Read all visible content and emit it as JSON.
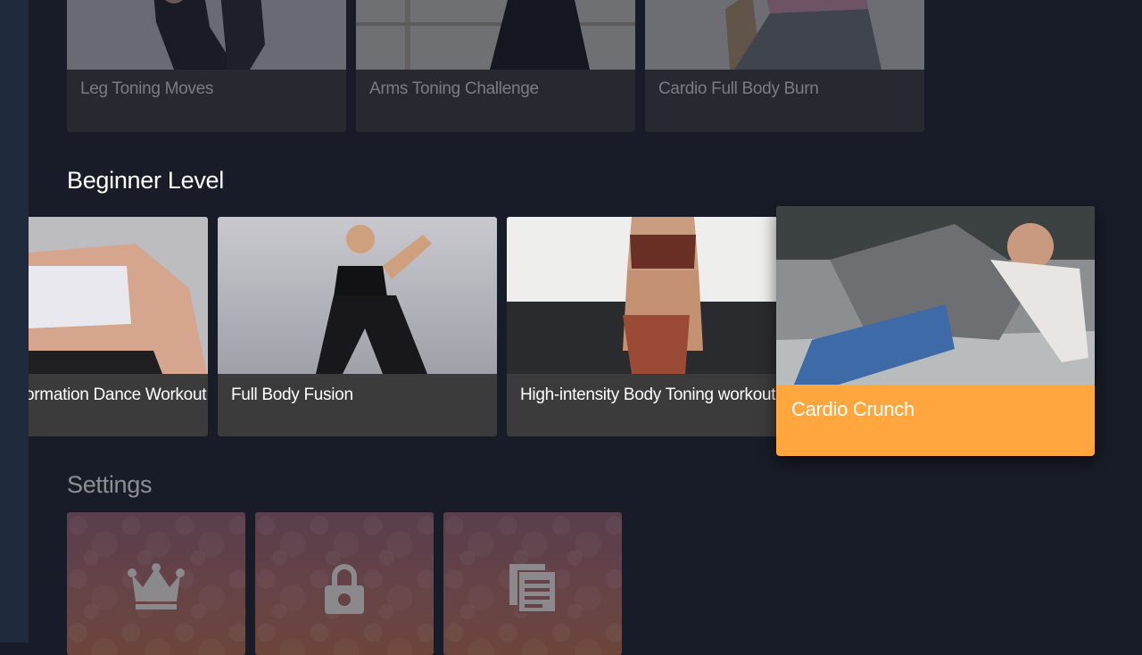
{
  "top_row": {
    "cards": [
      {
        "label": "Leg Toning Moves"
      },
      {
        "label": "Arms Toning Challenge"
      },
      {
        "label": "Cardio Full Body Burn"
      }
    ]
  },
  "beginner_row": {
    "title": "Beginner Level",
    "cards": [
      {
        "label": "ormation Dance Workout"
      },
      {
        "label": "Full Body Fusion"
      },
      {
        "label": "High-intensity Body Toning workout"
      },
      {
        "label": "Cardio Crunch",
        "focused": true
      }
    ]
  },
  "settings_row": {
    "title": "Settings",
    "tiles": [
      {
        "icon": "crown-icon"
      },
      {
        "icon": "lock-icon"
      },
      {
        "icon": "document-icon"
      }
    ]
  },
  "colors": {
    "background": "#171c28",
    "focus_accent": "#ffa73e",
    "card_label_bg": "#3b3b3b"
  }
}
